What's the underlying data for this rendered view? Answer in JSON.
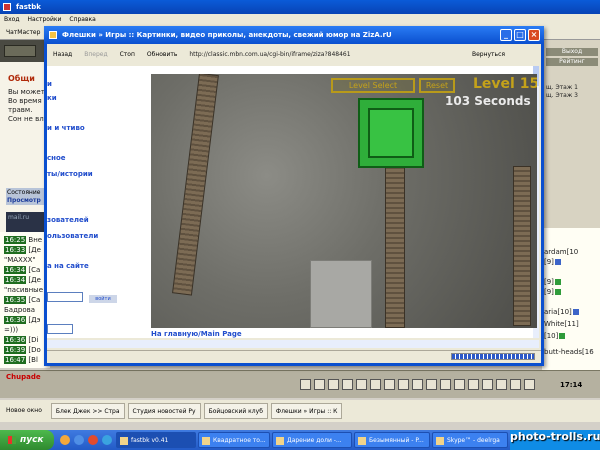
{
  "app": {
    "title": "fastbk",
    "menu": [
      "Вход",
      "Настройки",
      "Справка"
    ],
    "toolbar_label": "ЧатМастер"
  },
  "left_panel": {
    "heading": "Общи",
    "lines": [
      "Вы может",
      "Во время",
      "травм.",
      "Сон не вл"
    ],
    "status_lines": [
      "Состояние",
      "Просмотр"
    ],
    "mail_label": "mail.ru"
  },
  "chat": {
    "lines": [
      {
        "time": "16:25",
        "text": "Вне"
      },
      {
        "time": "16:33",
        "text": "[Де"
      },
      {
        "time": "",
        "text": "\"МАХХХ\""
      },
      {
        "time": "16:34",
        "text": "[Са"
      },
      {
        "time": "16:34",
        "text": "[Де"
      },
      {
        "time": "",
        "text": "\"пасивные"
      },
      {
        "time": "16:35",
        "text": "[Са"
      },
      {
        "time": "",
        "text": "Бадрова"
      },
      {
        "time": "16:36",
        "text": "[Дэ"
      },
      {
        "time": "",
        "text": "=)))"
      },
      {
        "time": "16:36",
        "text": "[Di"
      },
      {
        "time": "16:39",
        "text": "[Do"
      },
      {
        "time": "16:47",
        "text": "[Bl"
      }
    ],
    "bottom_line": "Chupade"
  },
  "right_panel": {
    "buttons": [
      "Выход",
      "Рейтинг"
    ],
    "small": [
      "щ. Этаж 1",
      "щ. Этаж 3"
    ],
    "names": [
      "ardam[10",
      "[9]",
      "[9]",
      "[9]",
      "aria[10]",
      "White[11]",
      "[10]",
      "butt-heads[16"
    ]
  },
  "bottom_bar": {
    "clock": "17:14"
  },
  "inner_tabs": [
    "Новое окно",
    "Блек Джек >> Стра",
    "Студия новостей Ру",
    "Бойцовский клуб",
    "Флешки » Игры :: К"
  ],
  "popup": {
    "title": "Флешки » Игры :: Картинки, видео приколы, анекдоты, свежий юмор на ZizA.rU",
    "nav": {
      "back": "Назад",
      "forward": "Вперед",
      "stop": "Стоп",
      "refresh": "Обновить",
      "url": "http://classic.mbn.com.ua/cgi-bin/iframe/ziza?848461",
      "return": "Вернуться"
    },
    "left_links": [
      "и",
      "ки",
      "и и чтиво",
      "сное",
      "ты/истории",
      "зователей",
      "ользователи",
      "а на сайте"
    ],
    "go_button": "войти",
    "main_link": "На главную/Main Page",
    "loading_progress": 1.0
  },
  "game": {
    "level_select": "Level Select",
    "reset": "Reset",
    "level": "Level 15",
    "timer": "103 Seconds"
  },
  "taskbar": {
    "start": "пуск",
    "tasks": [
      "fastbk v0.41",
      "Квадратное то...",
      "Дарение доли -...",
      "Безымянный - P...",
      "Skype™ - deelrga"
    ]
  },
  "watermark": "photo-trolls.ru"
}
